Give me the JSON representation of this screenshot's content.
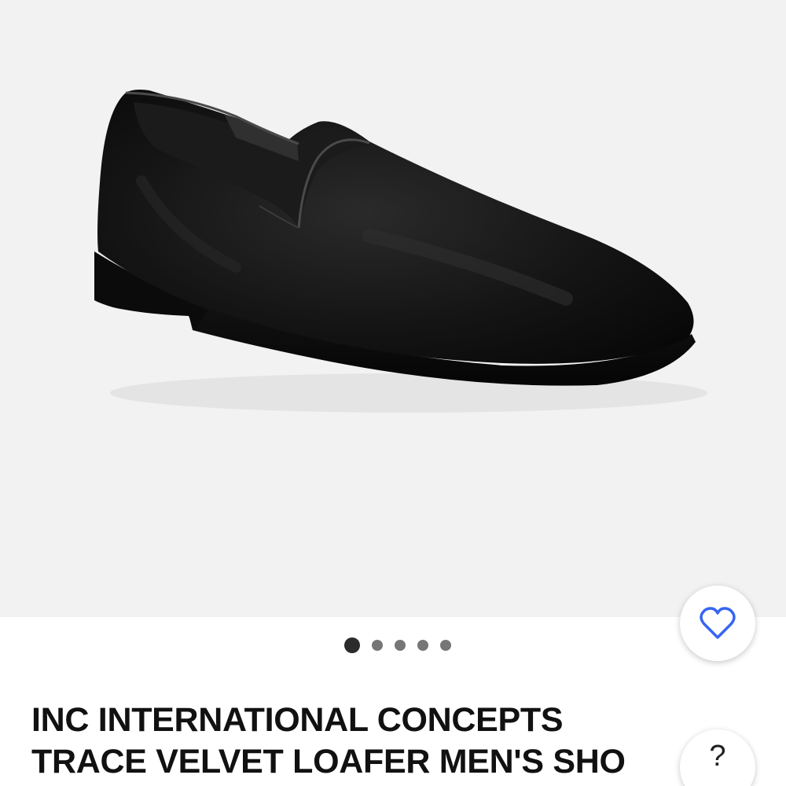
{
  "product": {
    "image_alt": "Black velvet loafer",
    "title_line1": "INC INTERNATIONAL CONCEPTS",
    "title_line2": "TRACE VELVET LOAFER MEN'S SHO"
  },
  "carousel": {
    "count": 5,
    "active_index": 0
  },
  "buttons": {
    "watch_icon": "heart-outline-icon",
    "help_label": "?"
  },
  "colors": {
    "accent_blue": "#3665f3",
    "hero_background": "#f2f2f2",
    "title_text": "#111111"
  }
}
